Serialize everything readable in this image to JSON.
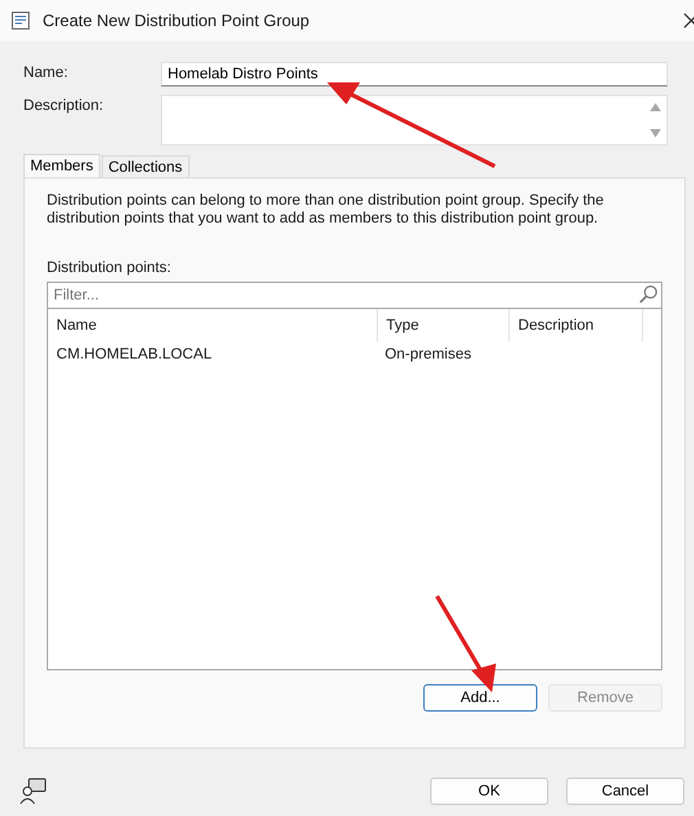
{
  "window": {
    "title": "Create New Distribution Point Group"
  },
  "fields": [
    {
      "label": "Name:",
      "value": "Homelab Distro Points",
      "kind": "text"
    },
    {
      "label": "Description:",
      "kind": "textarea"
    }
  ],
  "tabs": [
    {
      "label": "Members",
      "selected": true
    },
    {
      "label": "Collections",
      "selected": false
    }
  ],
  "members": {
    "description": "Distribution points can belong to more than one distribution point group. Specify the distribution points that you want to add as members to this distribution point group.",
    "list_label": "Distribution points:",
    "filter": {
      "placeholder": "Filter..."
    },
    "table": {
      "columns": [
        "Name",
        "Type",
        "Description"
      ],
      "rows": [
        [
          "CM.HOMELAB.LOCAL",
          "On-premises"
        ]
      ]
    },
    "buttons": [
      {
        "label": "Add...",
        "disabled": false
      },
      {
        "label": "Remove",
        "disabled": true
      }
    ]
  },
  "footer_buttons": [
    "OK",
    "Cancel"
  ]
}
